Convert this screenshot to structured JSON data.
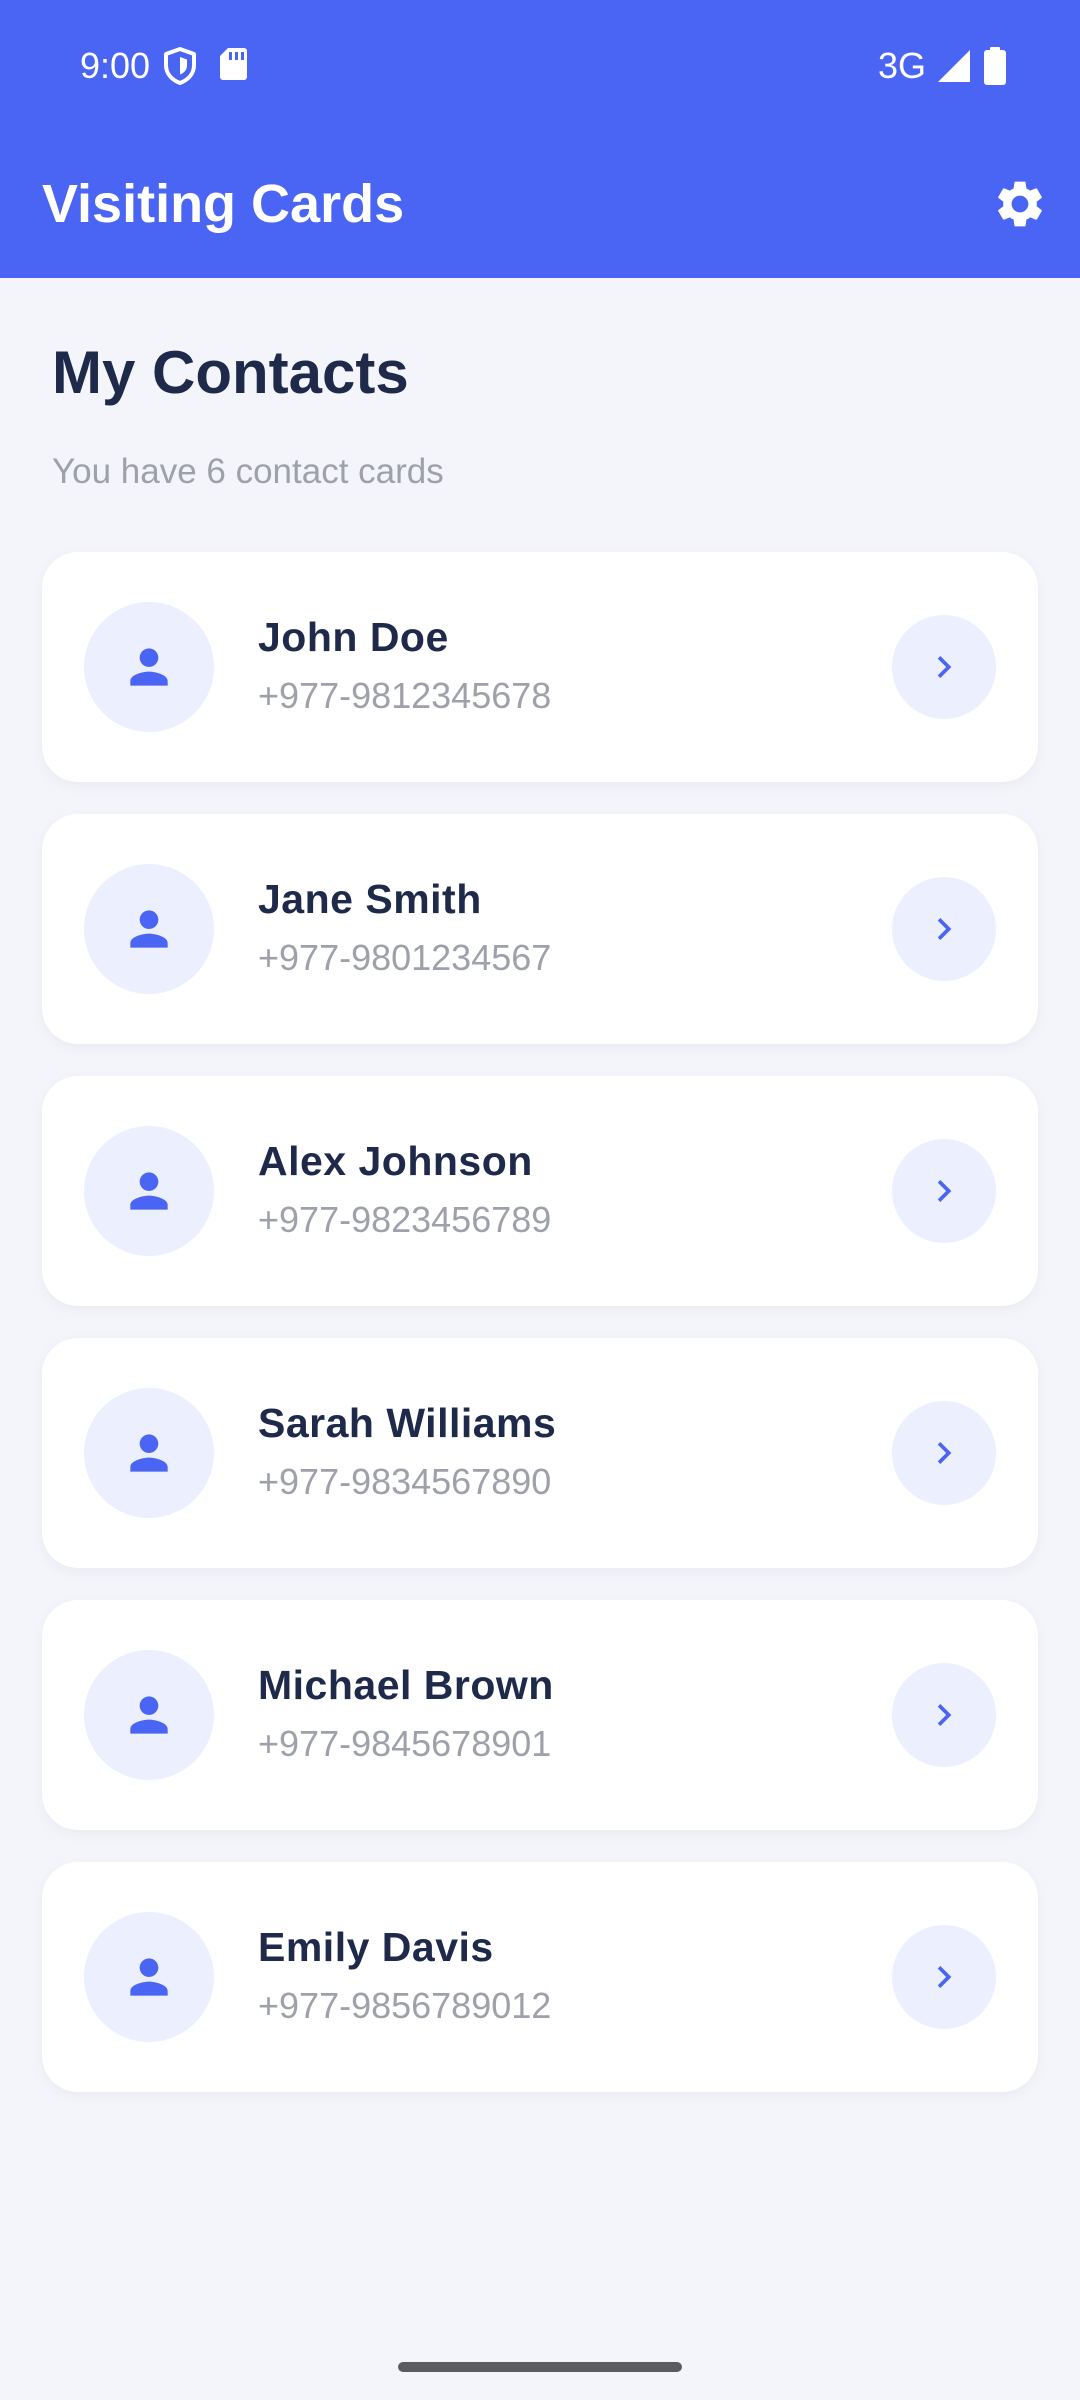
{
  "status_bar": {
    "time": "9:00",
    "network_type": "3G",
    "icons": [
      "shield-icon",
      "sd-card-icon",
      "signal-icon",
      "battery-icon"
    ]
  },
  "app_bar": {
    "title": "Visiting Cards",
    "settings_icon": "gear-icon"
  },
  "page": {
    "title": "My Contacts",
    "subtitle": "You have 6 contact cards"
  },
  "contacts": [
    {
      "name": "John Doe",
      "phone": "+977-9812345678"
    },
    {
      "name": "Jane Smith",
      "phone": "+977-9801234567"
    },
    {
      "name": "Alex Johnson",
      "phone": "+977-9823456789"
    },
    {
      "name": "Sarah Williams",
      "phone": "+977-9834567890"
    },
    {
      "name": "Michael Brown",
      "phone": "+977-9845678901"
    },
    {
      "name": "Emily Davis",
      "phone": "+977-9856789012"
    }
  ],
  "colors": {
    "primary": "#4a65f3",
    "background": "#f4f5fa",
    "card": "#ffffff",
    "title_text": "#1f2a4b",
    "secondary_text": "#9ea1aa",
    "icon_bg": "#eceffd"
  }
}
